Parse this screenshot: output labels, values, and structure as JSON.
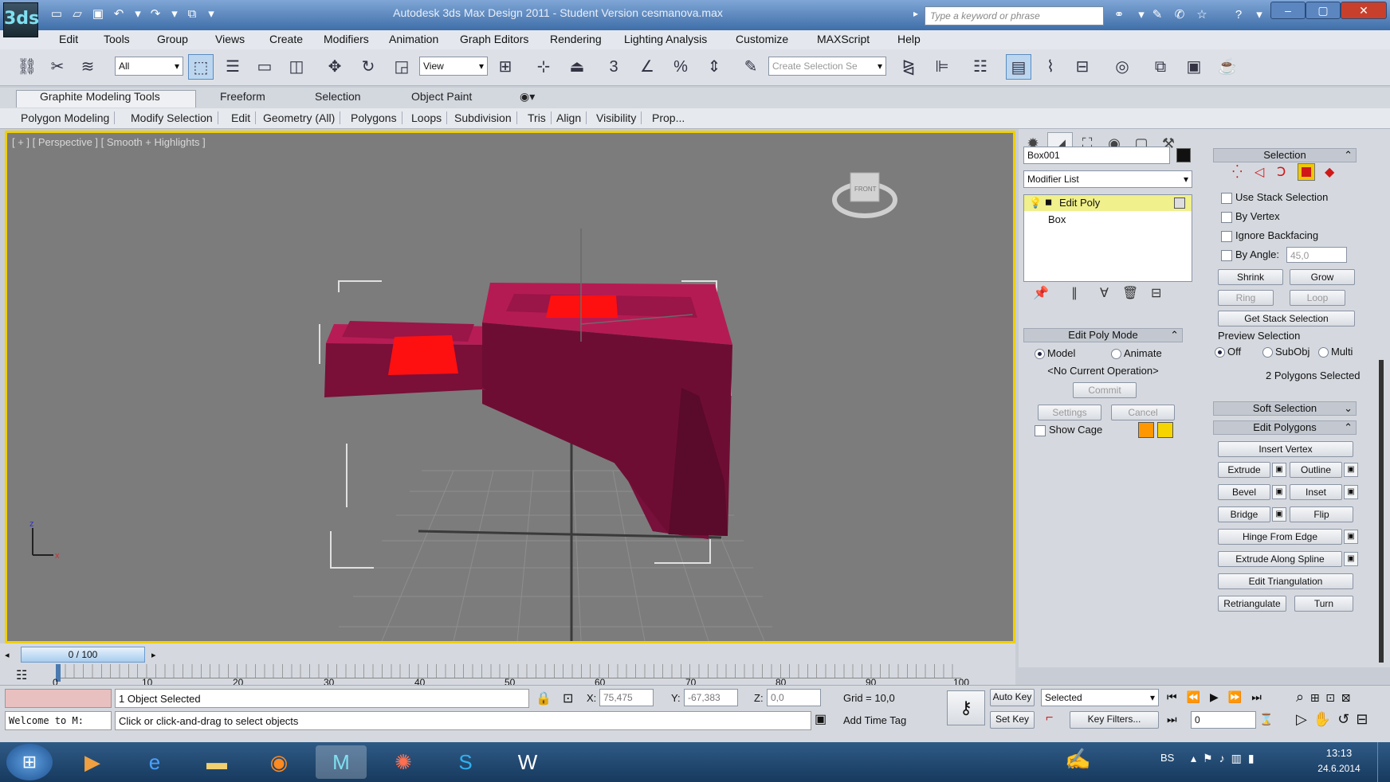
{
  "window": {
    "title": "Autodesk 3ds Max Design 2011  -  Student Version    cesmanova.max",
    "search_placeholder": "Type a keyword or phrase",
    "logo_text": "3ds"
  },
  "menu": [
    "Edit",
    "Tools",
    "Group",
    "Views",
    "Create",
    "Modifiers",
    "Animation",
    "Graph Editors",
    "Rendering",
    "Lighting Analysis",
    "Customize",
    "MAXScript",
    "Help"
  ],
  "toolbar": {
    "filter_value": "All",
    "ref_coord_value": "View",
    "selection_set_placeholder": "Create Selection Se",
    "snap_label": "3",
    "angle_snap_label": "%"
  },
  "ribbon": {
    "tabs": [
      "Graphite Modeling Tools",
      "Freeform",
      "Selection",
      "Object Paint"
    ],
    "subtabs": [
      "Polygon Modeling",
      "Modify Selection",
      "Edit",
      "Geometry (All)",
      "Polygons",
      "Loops",
      "Subdivision",
      "Tris",
      "Align",
      "Visibility",
      "Prop..."
    ]
  },
  "viewport": {
    "label": "[ + ] [ Perspective ] [ Smooth + Highlights ]",
    "viewcube_label": "FRONT",
    "axis_x": "x",
    "axis_y": "z",
    "object_color": "#8a1040",
    "selected_poly_color": "#ff1010",
    "border_color": "#f0d000"
  },
  "command_panel": {
    "object_name": "Box001",
    "modifier_list": "Modifier List",
    "stack": [
      "Edit Poly",
      "Box"
    ],
    "edit_poly_mode": {
      "header": "Edit Poly Mode",
      "model": "Model",
      "animate": "Animate",
      "operation": "<No Current Operation>",
      "commit": "Commit",
      "settings": "Settings",
      "cancel": "Cancel",
      "show_cage": "Show Cage"
    }
  },
  "selection_rollout": {
    "header": "Selection",
    "use_stack": "Use Stack Selection",
    "by_vertex": "By Vertex",
    "ignore_backfacing": "Ignore Backfacing",
    "by_angle": "By Angle:",
    "angle_value": "45,0",
    "shrink": "Shrink",
    "grow": "Grow",
    "ring": "Ring",
    "loop": "Loop",
    "get_stack": "Get Stack Selection",
    "preview": "Preview Selection",
    "off": "Off",
    "subobj": "SubObj",
    "multi": "Multi",
    "status": "2 Polygons Selected"
  },
  "soft_selection": {
    "header": "Soft Selection"
  },
  "edit_polygons": {
    "header": "Edit Polygons",
    "insert_vertex": "Insert Vertex",
    "extrude": "Extrude",
    "outline": "Outline",
    "bevel": "Bevel",
    "inset": "Inset",
    "bridge": "Bridge",
    "flip": "Flip",
    "hinge": "Hinge From Edge",
    "extrude_spline": "Extrude Along Spline",
    "edit_tri": "Edit Triangulation",
    "retriangulate": "Retriangulate",
    "turn": "Turn"
  },
  "timeline": {
    "slider": "0 / 100",
    "ticks": [
      "0",
      "10",
      "20",
      "30",
      "40",
      "50",
      "60",
      "70",
      "80",
      "90",
      "100"
    ]
  },
  "status": {
    "maxscript": "Welcome to M:",
    "selected": "1 Object Selected",
    "prompt": "Click or click-and-drag to select objects",
    "x_label": "X:",
    "x_value": "75,475",
    "y_label": "Y:",
    "y_value": "-67,383",
    "z_label": "Z:",
    "z_value": "0,0",
    "grid": "Grid = 10,0",
    "add_time_tag": "Add Time Tag",
    "auto_key": "Auto Key",
    "set_key": "Set Key",
    "key_mode": "Selected",
    "key_filters": "Key Filters...",
    "frame": "0"
  },
  "taskbar": {
    "lang": "BS",
    "time": "13:13",
    "date": "24.6.2014"
  }
}
